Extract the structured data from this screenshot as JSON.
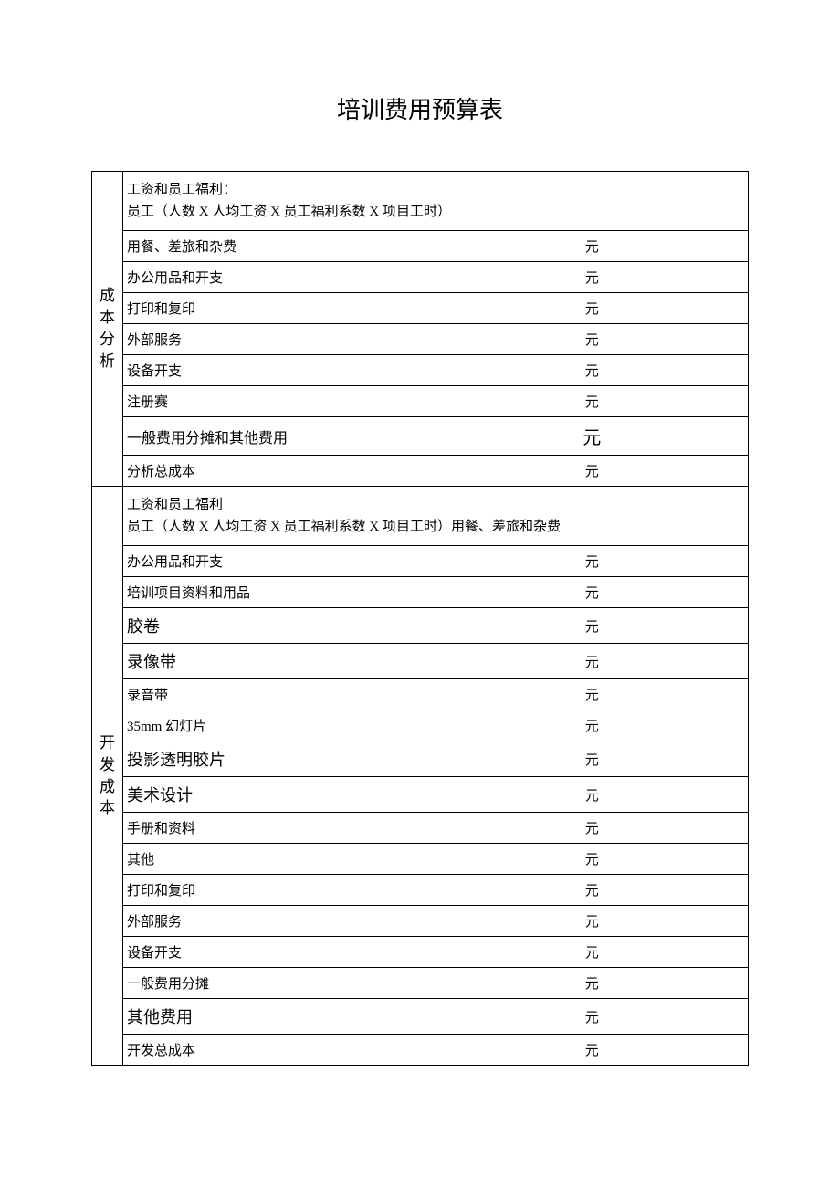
{
  "title": "培训费用预算表",
  "unit": "元",
  "sections": {
    "s1": {
      "label": "成本分析",
      "header_l1": "工资和员工福利：",
      "header_l2": "员工（人数 X 人均工资 X 员工福利系数 X 项目工时）",
      "items": {
        "r1": "用餐、差旅和杂费",
        "r2": "办公用品和开支",
        "r3": "打印和复印",
        "r4": "外部服务",
        "r5": "设备开支",
        "r6": "注册赛",
        "r7": "一般费用分摊和其他费用",
        "r8": "分析总成本"
      }
    },
    "s2": {
      "label": "开发成本",
      "header_l1": "工资和员工福利",
      "header_l2": "员工（人数 X 人均工资 X 员工福利系数 X 项目工时）用餐、差旅和杂费",
      "items": {
        "r1": "办公用品和开支",
        "r2": "培训项目资料和用品",
        "r3": "胶卷",
        "r4": "录像带",
        "r5": "录音带",
        "r6": "35mm 幻灯片",
        "r7": "投影透明胶片",
        "r8": "美术设计",
        "r9": "手册和资料",
        "r10": "其他",
        "r11": "打印和复印",
        "r12": "外部服务",
        "r13": "设备开支",
        "r14": "一般费用分摊",
        "r15": "其他费用",
        "r16": "开发总成本"
      }
    }
  }
}
